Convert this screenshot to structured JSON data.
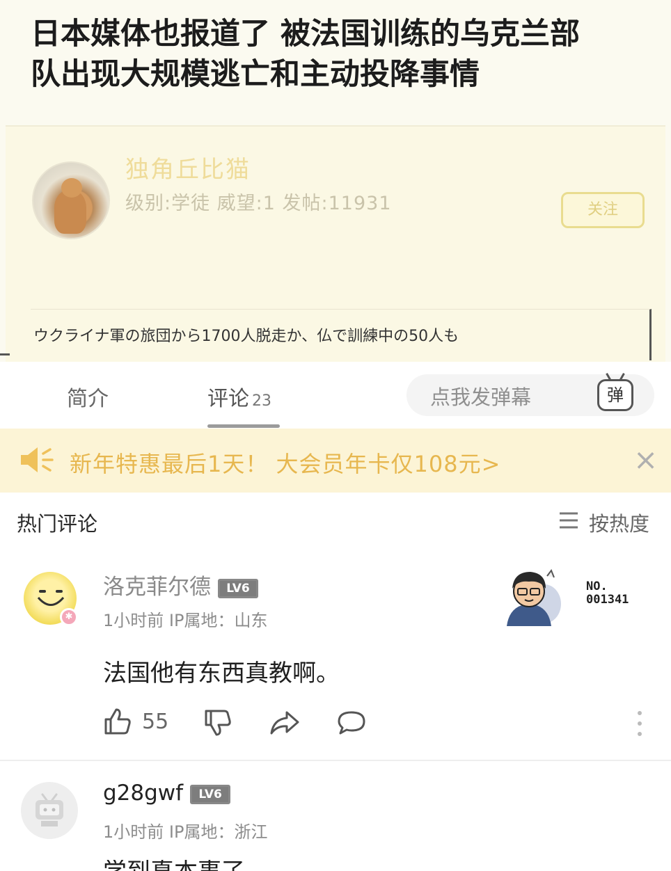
{
  "headline": {
    "line1": "日本媒体也报道了 被法国训练的乌克兰部",
    "line2": "队出现大规模逃亡和主动投降事情"
  },
  "post": {
    "username": "独角丘比猫",
    "stats": "级别:学徒 威望:1 发帖:11931",
    "follow_label": "关注",
    "quote": "ウクライナ軍の旅団から1700人脱走か、仏で訓練中の50人も"
  },
  "tabs": {
    "intro": "简介",
    "comments": "评论",
    "comments_count": "23",
    "danmaku_placeholder": "点我发弹幕",
    "danmaku_icon_char": "弹"
  },
  "promo": {
    "text": "新年特惠最后1天！ 大会员年卡仅108元>",
    "close": "×"
  },
  "comments_section": {
    "title": "热门评论",
    "sort_label": "按热度"
  },
  "comments": [
    {
      "name": "洛克菲尔德",
      "level": "LV6",
      "meta": "1小时前 IP属地：山东",
      "text": "法国他有东西真教啊。",
      "likes": "55",
      "no_line1": "NO.",
      "no_line2": "001341"
    },
    {
      "name": "g28gwf",
      "level": "LV6",
      "meta": "1小时前 IP属地：浙江",
      "text": "学到真本事了"
    }
  ],
  "icons": {
    "speaker": "speaker-icon",
    "sort": "sort-lines-icon",
    "like": "thumbs-up-icon",
    "dislike": "thumbs-down-icon",
    "share": "share-icon",
    "reply": "comment-bubble-icon",
    "more": "more-vertical-icon"
  },
  "colors": {
    "promo_text": "#e7b74f",
    "promo_bg": "#fcf4d6",
    "page_bg": "#fbfaf0"
  }
}
